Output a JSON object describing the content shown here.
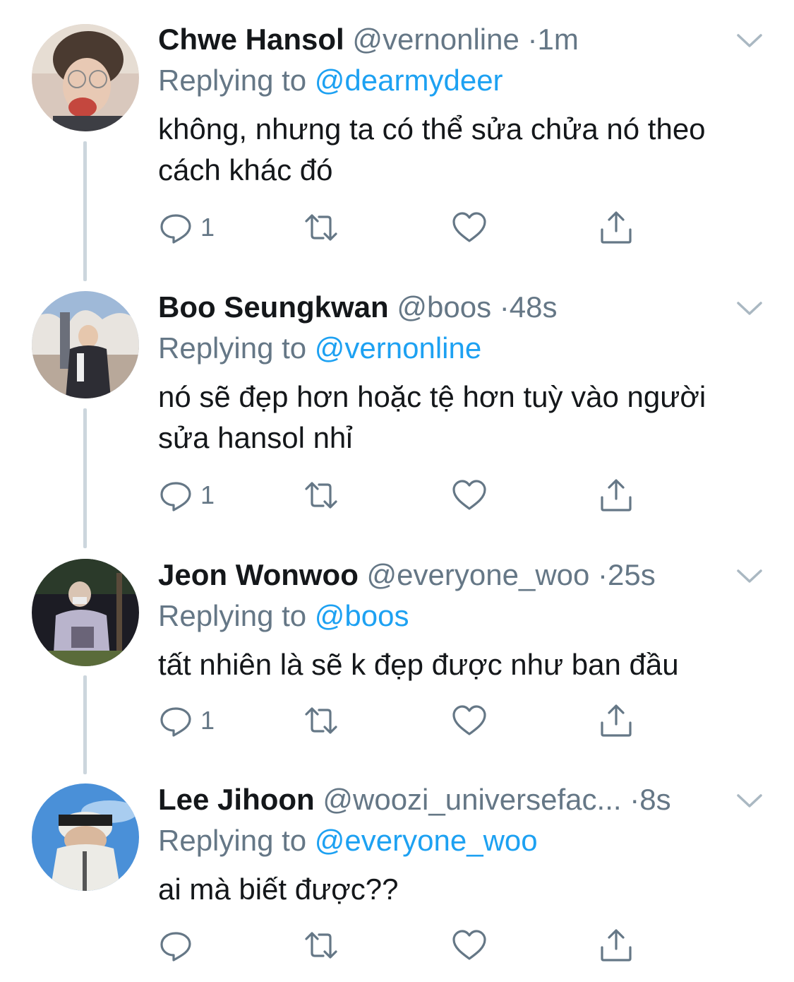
{
  "tweets": [
    {
      "name": "Chwe Hansol",
      "handle": "@vernonline",
      "separator": "·",
      "time": "1m",
      "replying_prefix": "Replying to",
      "replying_to": "@dearmydeer",
      "text": "không, nhưng ta có thể sửa chửa nó theo cách khác đó",
      "reply_count": "1",
      "avatar_colors": [
        "#d9c8bd",
        "#4a3a30",
        "#c4473e"
      ]
    },
    {
      "name": "Boo Seungkwan",
      "handle": "@boos",
      "separator": "·",
      "time": "48s",
      "replying_prefix": "Replying to",
      "replying_to": "@vernonline",
      "text": "nó sẽ đẹp hơn hoặc tệ hơn tuỳ vào người sửa hansol nhỉ",
      "reply_count": "1",
      "avatar_colors": [
        "#9fb9d8",
        "#e8e4df",
        "#2d2d34"
      ]
    },
    {
      "name": "Jeon Wonwoo",
      "handle": "@everyone_woo",
      "separator": "·",
      "time": "25s",
      "replying_prefix": "Replying to",
      "replying_to": "@boos",
      "text": "tất nhiên là sẽ k đẹp được như ban đầu",
      "reply_count": "1",
      "avatar_colors": [
        "#1c1c24",
        "#b9b4cc",
        "#5a6b3a"
      ]
    },
    {
      "name": "Lee Jihoon",
      "handle": "@woozi_universefac...",
      "separator": "·",
      "time": "8s",
      "replying_prefix": "Replying to",
      "replying_to": "@everyone_woo",
      "text": "ai mà biết được??",
      "reply_count": "",
      "avatar_colors": [
        "#4a90d8",
        "#ecebe6",
        "#1f1f1f"
      ]
    }
  ],
  "icons": {
    "reply": "reply-bubble-icon",
    "retweet": "retweet-arrows-icon",
    "like": "heart-icon",
    "share": "share-upload-icon",
    "more": "chevron-down-icon"
  },
  "colors": {
    "text": "#14171a",
    "secondary": "#657786",
    "link": "#1da1f2",
    "thread_line": "#ccd6dd",
    "background": "#ffffff"
  }
}
